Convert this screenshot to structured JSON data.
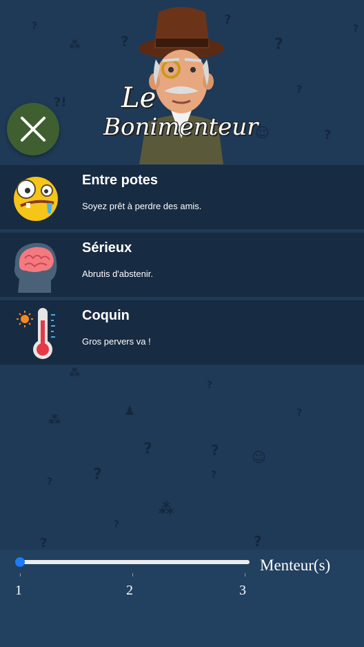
{
  "logo": {
    "line1": "Le",
    "line2": "Bonimenteur"
  },
  "close_icon": "close-icon",
  "modes": [
    {
      "title": "Entre potes",
      "description": "Soyez prêt à perdre des amis.",
      "icon": "crazy-face-icon"
    },
    {
      "title": "Sérieux",
      "description": "Abrutis d'abstenir.",
      "icon": "brain-head-icon"
    },
    {
      "title": "Coquin",
      "description": "Gros pervers va !",
      "icon": "thermometer-icon"
    }
  ],
  "slider": {
    "label": "Menteur(s)",
    "min": 1,
    "max": 3,
    "value": 1,
    "ticks": [
      "1",
      "2",
      "3"
    ]
  },
  "colors": {
    "background": "#1f3a57",
    "card": "#172b42",
    "close_button": "#3f5f30",
    "slider_thumb": "#1a7cf7"
  }
}
